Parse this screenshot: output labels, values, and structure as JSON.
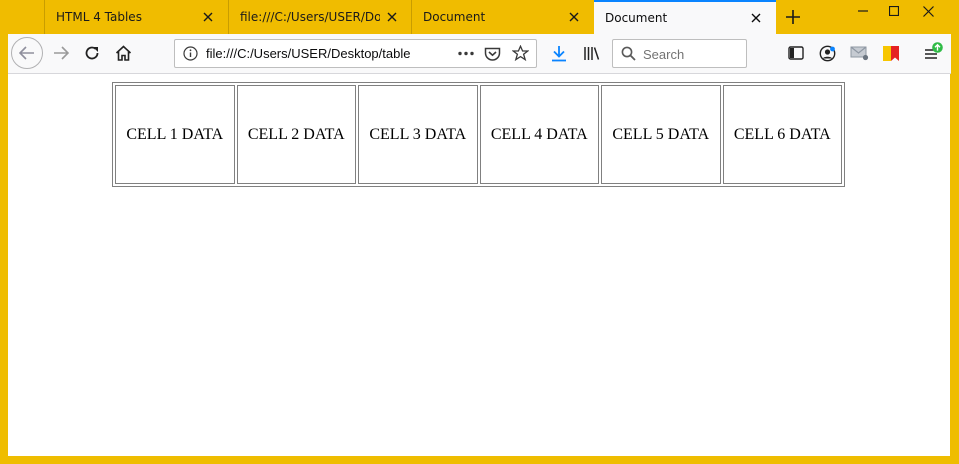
{
  "tabs": [
    {
      "label": "HTML 4 Tables",
      "active": false
    },
    {
      "label": "file:///C:/Users/USER/Documents",
      "active": false
    },
    {
      "label": "Document",
      "active": false
    },
    {
      "label": "Document",
      "active": true
    }
  ],
  "toolbar": {
    "url": "file:///C:/Users/USER/Desktop/table",
    "search_placeholder": "Search"
  },
  "table": {
    "cells": [
      "CELL 1 DATA",
      "CELL 2 DATA",
      "CELL 3 DATA",
      "CELL 4 DATA",
      "CELL 5 DATA",
      "CELL 6 DATA"
    ]
  },
  "colors": {
    "window_frame": "#efbd00",
    "active_tab_accent": "#0a84ff",
    "toolbar": "#f9f9fa"
  }
}
